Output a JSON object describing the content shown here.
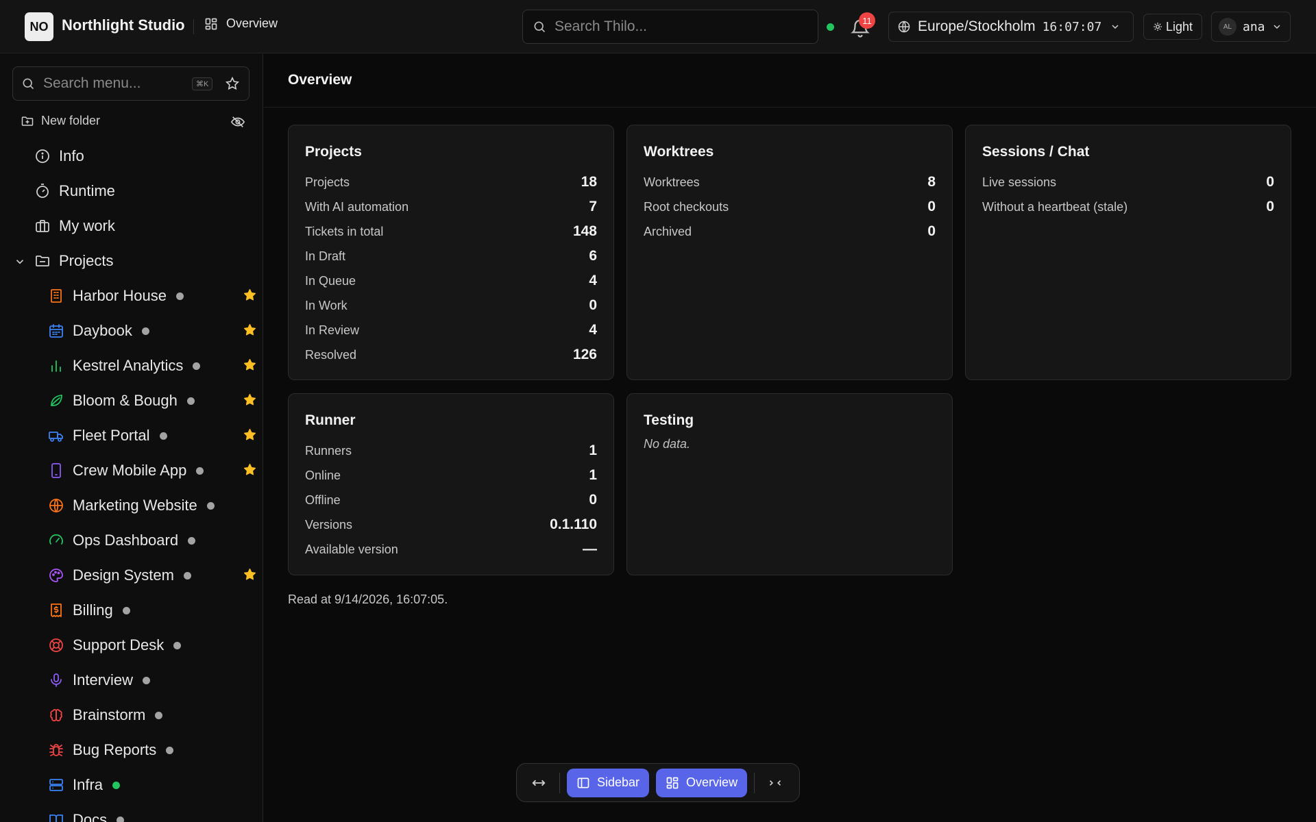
{
  "app": {
    "logo": "NO",
    "title": "Northlight Studio",
    "crumb": "Overview"
  },
  "search": {
    "placeholder": "Search Thilo..."
  },
  "notifications": {
    "count": "11"
  },
  "timezone": {
    "name": "Europe/Stockholm",
    "time": "16:07:07"
  },
  "theme": {
    "label": "Light"
  },
  "user": {
    "initials": "AL",
    "name": "ana"
  },
  "sidebar": {
    "search_placeholder": "Search menu...",
    "shortcut": "⌘K",
    "new_folder": "New folder",
    "nav": [
      {
        "label": "Info",
        "icon": "info-icon"
      },
      {
        "label": "Runtime",
        "icon": "stopwatch-icon"
      },
      {
        "label": "My work",
        "icon": "briefcase-icon"
      },
      {
        "label": "Projects",
        "icon": "folder-icon"
      }
    ],
    "projects": [
      {
        "label": "Harbor House",
        "icon": "building-icon",
        "color": "#f97316",
        "starred": true,
        "online": false
      },
      {
        "label": "Daybook",
        "icon": "calendar-icon",
        "color": "#3b82f6",
        "starred": true,
        "online": false
      },
      {
        "label": "Kestrel Analytics",
        "icon": "bar-chart-icon",
        "color": "#22c55e",
        "starred": true,
        "online": false
      },
      {
        "label": "Bloom & Bough",
        "icon": "leaf-icon",
        "color": "#22c55e",
        "starred": true,
        "online": false
      },
      {
        "label": "Fleet Portal",
        "icon": "truck-icon",
        "color": "#3b82f6",
        "starred": true,
        "online": false
      },
      {
        "label": "Crew Mobile App",
        "icon": "smartphone-icon",
        "color": "#8b5cf6",
        "starred": true,
        "online": false
      },
      {
        "label": "Marketing Website",
        "icon": "globe-icon",
        "color": "#f97316",
        "starred": false,
        "online": false
      },
      {
        "label": "Ops Dashboard",
        "icon": "gauge-icon",
        "color": "#22c55e",
        "starred": false,
        "online": false
      },
      {
        "label": "Design System",
        "icon": "palette-icon",
        "color": "#a855f7",
        "starred": true,
        "online": false
      },
      {
        "label": "Billing",
        "icon": "receipt-icon",
        "color": "#f97316",
        "starred": false,
        "online": false
      },
      {
        "label": "Support Desk",
        "icon": "lifebuoy-icon",
        "color": "#ef4444",
        "starred": false,
        "online": false
      },
      {
        "label": "Interview",
        "icon": "microphone-icon",
        "color": "#8b5cf6",
        "starred": false,
        "online": false
      },
      {
        "label": "Brainstorm",
        "icon": "brain-icon",
        "color": "#ef4444",
        "starred": false,
        "online": false
      },
      {
        "label": "Bug Reports",
        "icon": "bug-icon",
        "color": "#ef4444",
        "starred": false,
        "online": false
      },
      {
        "label": "Infra",
        "icon": "server-icon",
        "color": "#3b82f6",
        "starred": false,
        "online": true
      },
      {
        "label": "Docs",
        "icon": "book-icon",
        "color": "#3b82f6",
        "starred": false,
        "online": false
      }
    ]
  },
  "main": {
    "title": "Overview",
    "cards": {
      "projects": {
        "title": "Projects",
        "rows": [
          {
            "k": "Projects",
            "v": "18"
          },
          {
            "k": "With AI automation",
            "v": "7"
          },
          {
            "k": "Tickets in total",
            "v": "148"
          },
          {
            "k": "In Draft",
            "v": "6"
          },
          {
            "k": "In Queue",
            "v": "4"
          },
          {
            "k": "In Work",
            "v": "0"
          },
          {
            "k": "In Review",
            "v": "4"
          },
          {
            "k": "Resolved",
            "v": "126"
          }
        ]
      },
      "worktrees": {
        "title": "Worktrees",
        "rows": [
          {
            "k": "Worktrees",
            "v": "8"
          },
          {
            "k": "Root checkouts",
            "v": "0"
          },
          {
            "k": "Archived",
            "v": "0"
          }
        ]
      },
      "sessions": {
        "title": "Sessions / Chat",
        "rows": [
          {
            "k": "Live sessions",
            "v": "0"
          },
          {
            "k": "Without a heartbeat (stale)",
            "v": "0"
          }
        ]
      },
      "runner": {
        "title": "Runner",
        "rows": [
          {
            "k": "Runners",
            "v": "1"
          },
          {
            "k": "Online",
            "v": "1"
          },
          {
            "k": "Offline",
            "v": "0"
          },
          {
            "k": "Versions",
            "v": "0.1.110"
          },
          {
            "k": "Available version",
            "v": "—"
          }
        ]
      },
      "testing": {
        "title": "Testing",
        "empty": "No data."
      }
    },
    "read_at": "Read at 9/14/2026, 16:07:05."
  },
  "dock": {
    "sidebar_label": "Sidebar",
    "overview_label": "Overview"
  },
  "colors": {
    "accent": "#5865e8",
    "star": "#fbbf24",
    "online": "#22c55e",
    "badge": "#ef4444"
  }
}
